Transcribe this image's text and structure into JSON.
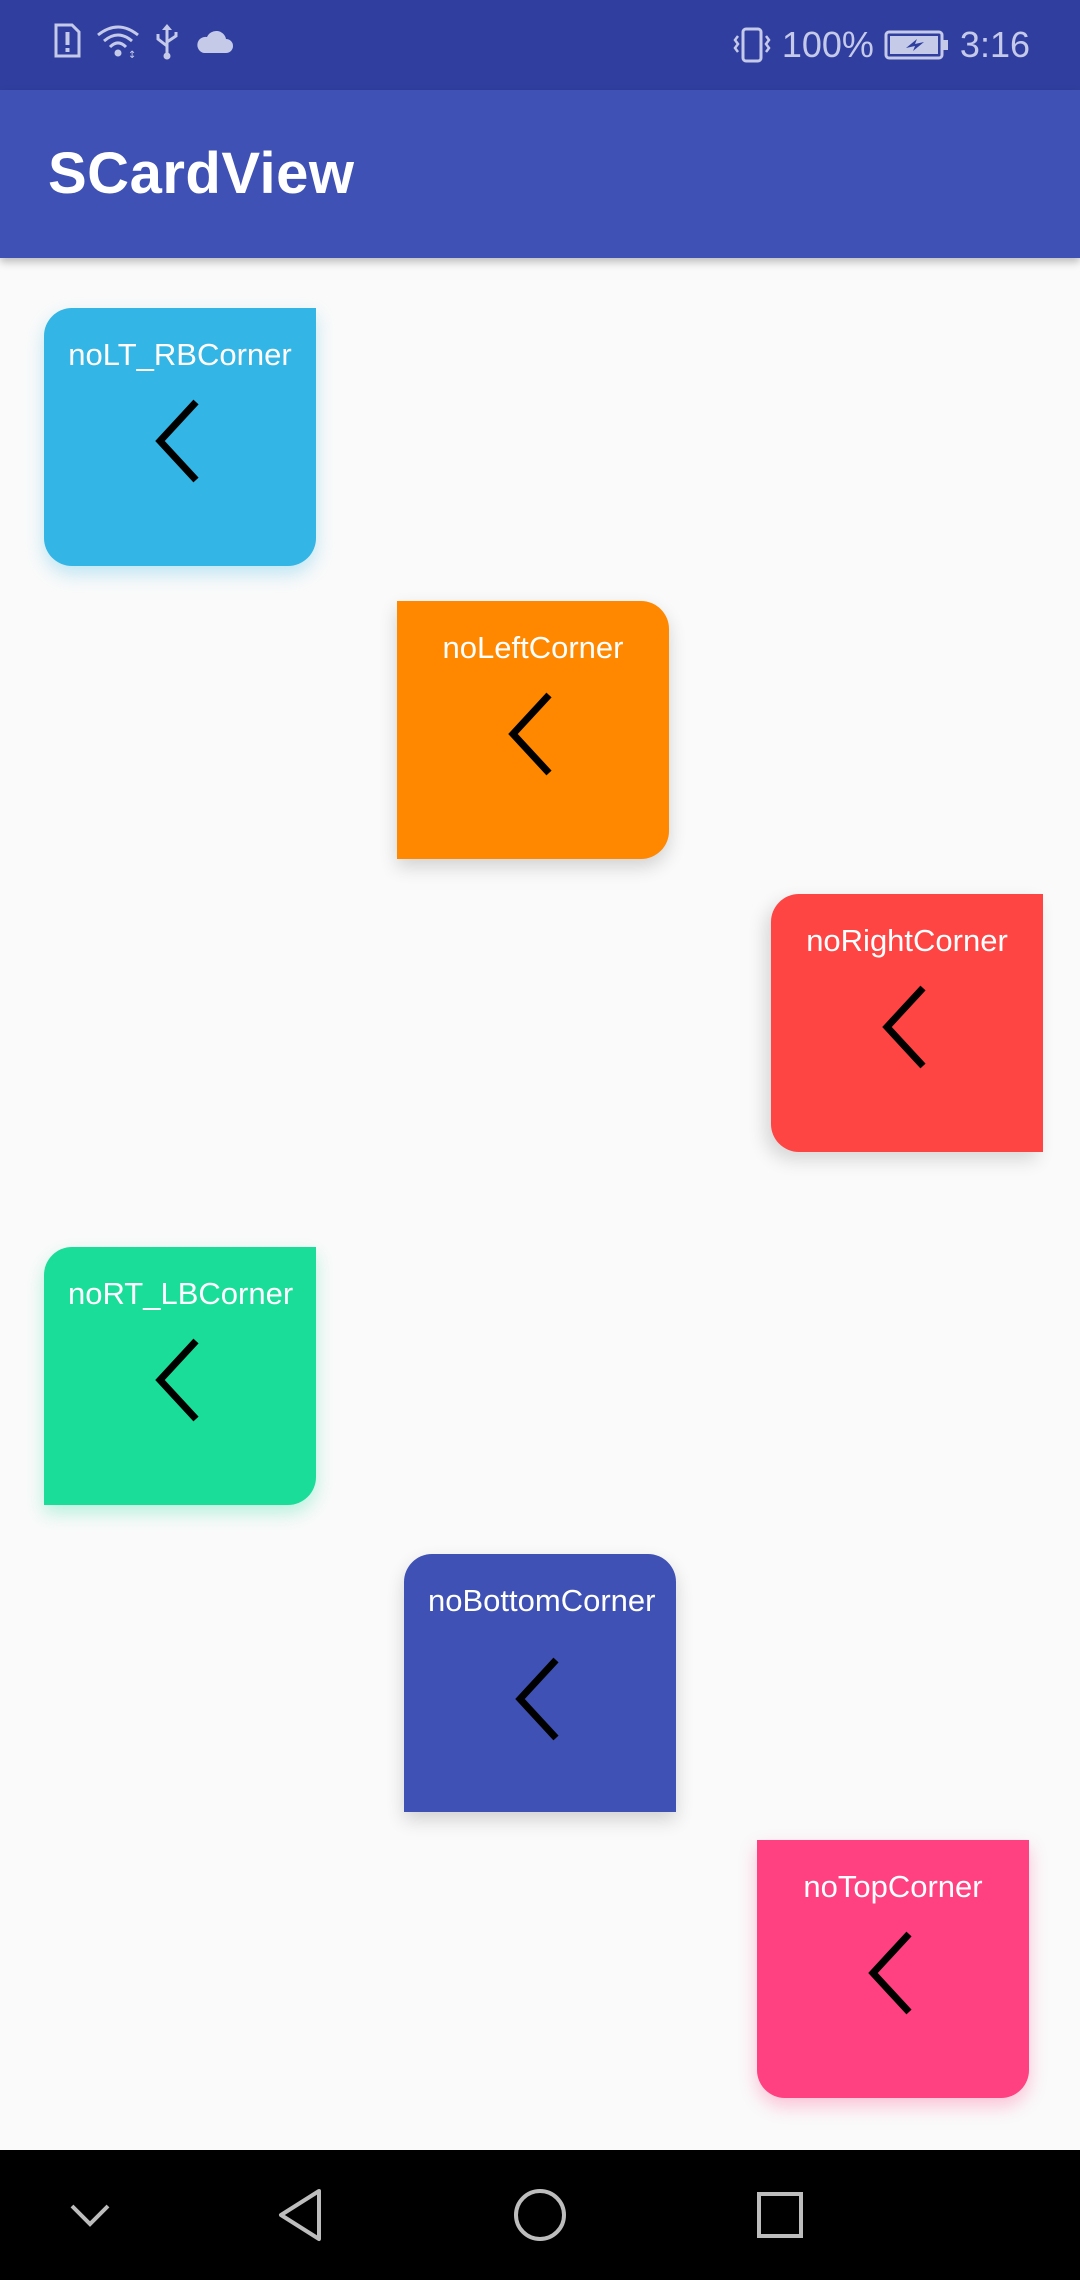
{
  "status_bar": {
    "battery_percent": "100%",
    "time": "3:16",
    "icons": [
      "sim-alert-icon",
      "wifi-icon",
      "usb-icon",
      "cloud-icon",
      "vibrate-icon",
      "battery-charging-icon"
    ]
  },
  "app_bar": {
    "title": "SCardView"
  },
  "cards": [
    {
      "label": "noLT_RBCorner",
      "color": "#33b5e5",
      "icon": "chevron-left-icon"
    },
    {
      "label": "noLeftCorner",
      "color": "#ff8800",
      "icon": "chevron-left-icon"
    },
    {
      "label": "noRightCorner",
      "color": "#ff4444",
      "icon": "chevron-left-icon"
    },
    {
      "label": "noRT_LBCorner",
      "color": "#1bdd9a",
      "icon": "chevron-left-icon"
    },
    {
      "label": "noBottomCorner",
      "color": "#3f51b5",
      "icon": "chevron-left-icon"
    },
    {
      "label": "noTopCorner",
      "color": "#ff4081",
      "icon": "chevron-left-icon"
    }
  ],
  "nav_bar": {
    "buttons": [
      "hide-keyboard-icon",
      "back-icon",
      "home-icon",
      "recents-icon"
    ]
  }
}
